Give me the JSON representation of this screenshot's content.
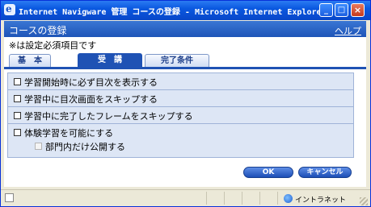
{
  "window": {
    "title": "Internet Navigware 管理 コースの登録 - Microsoft Internet Explorer",
    "minimize_glyph": "_",
    "maximize_glyph": "□",
    "close_glyph": "×"
  },
  "header": {
    "title": "コースの登録",
    "help": "ヘルプ"
  },
  "note": "※は設定必須項目です",
  "tabs": [
    {
      "label": "基　本",
      "active": false
    },
    {
      "label": "受　講",
      "active": true
    },
    {
      "label": "完了条件",
      "active": false
    }
  ],
  "options": [
    {
      "label": "学習開始時に必ず目次を表示する",
      "checked": false
    },
    {
      "label": "学習中に目次画面をスキップする",
      "checked": false
    },
    {
      "label": "学習中に完了したフレームをスキップする",
      "checked": false
    },
    {
      "label": "体験学習を可能にする",
      "checked": false
    },
    {
      "label": "部門内だけ公開する",
      "checked": false,
      "disabled": true
    }
  ],
  "buttons": {
    "ok": "OK",
    "cancel": "キャンセル"
  },
  "statusbar": {
    "zone": "イントラネット"
  },
  "colors": {
    "header": "#1e55b8",
    "active_tab": "#1f52b4",
    "panel": "#dde6f5"
  }
}
